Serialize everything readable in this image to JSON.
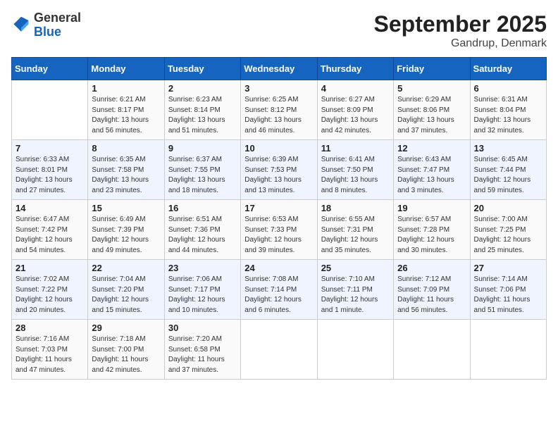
{
  "header": {
    "logo_general": "General",
    "logo_blue": "Blue",
    "month_title": "September 2025",
    "location": "Gandrup, Denmark"
  },
  "weekdays": [
    "Sunday",
    "Monday",
    "Tuesday",
    "Wednesday",
    "Thursday",
    "Friday",
    "Saturday"
  ],
  "weeks": [
    [
      {
        "day": "",
        "info": ""
      },
      {
        "day": "1",
        "info": "Sunrise: 6:21 AM\nSunset: 8:17 PM\nDaylight: 13 hours\nand 56 minutes."
      },
      {
        "day": "2",
        "info": "Sunrise: 6:23 AM\nSunset: 8:14 PM\nDaylight: 13 hours\nand 51 minutes."
      },
      {
        "day": "3",
        "info": "Sunrise: 6:25 AM\nSunset: 8:12 PM\nDaylight: 13 hours\nand 46 minutes."
      },
      {
        "day": "4",
        "info": "Sunrise: 6:27 AM\nSunset: 8:09 PM\nDaylight: 13 hours\nand 42 minutes."
      },
      {
        "day": "5",
        "info": "Sunrise: 6:29 AM\nSunset: 8:06 PM\nDaylight: 13 hours\nand 37 minutes."
      },
      {
        "day": "6",
        "info": "Sunrise: 6:31 AM\nSunset: 8:04 PM\nDaylight: 13 hours\nand 32 minutes."
      }
    ],
    [
      {
        "day": "7",
        "info": "Sunrise: 6:33 AM\nSunset: 8:01 PM\nDaylight: 13 hours\nand 27 minutes."
      },
      {
        "day": "8",
        "info": "Sunrise: 6:35 AM\nSunset: 7:58 PM\nDaylight: 13 hours\nand 23 minutes."
      },
      {
        "day": "9",
        "info": "Sunrise: 6:37 AM\nSunset: 7:55 PM\nDaylight: 13 hours\nand 18 minutes."
      },
      {
        "day": "10",
        "info": "Sunrise: 6:39 AM\nSunset: 7:53 PM\nDaylight: 13 hours\nand 13 minutes."
      },
      {
        "day": "11",
        "info": "Sunrise: 6:41 AM\nSunset: 7:50 PM\nDaylight: 13 hours\nand 8 minutes."
      },
      {
        "day": "12",
        "info": "Sunrise: 6:43 AM\nSunset: 7:47 PM\nDaylight: 13 hours\nand 3 minutes."
      },
      {
        "day": "13",
        "info": "Sunrise: 6:45 AM\nSunset: 7:44 PM\nDaylight: 12 hours\nand 59 minutes."
      }
    ],
    [
      {
        "day": "14",
        "info": "Sunrise: 6:47 AM\nSunset: 7:42 PM\nDaylight: 12 hours\nand 54 minutes."
      },
      {
        "day": "15",
        "info": "Sunrise: 6:49 AM\nSunset: 7:39 PM\nDaylight: 12 hours\nand 49 minutes."
      },
      {
        "day": "16",
        "info": "Sunrise: 6:51 AM\nSunset: 7:36 PM\nDaylight: 12 hours\nand 44 minutes."
      },
      {
        "day": "17",
        "info": "Sunrise: 6:53 AM\nSunset: 7:33 PM\nDaylight: 12 hours\nand 39 minutes."
      },
      {
        "day": "18",
        "info": "Sunrise: 6:55 AM\nSunset: 7:31 PM\nDaylight: 12 hours\nand 35 minutes."
      },
      {
        "day": "19",
        "info": "Sunrise: 6:57 AM\nSunset: 7:28 PM\nDaylight: 12 hours\nand 30 minutes."
      },
      {
        "day": "20",
        "info": "Sunrise: 7:00 AM\nSunset: 7:25 PM\nDaylight: 12 hours\nand 25 minutes."
      }
    ],
    [
      {
        "day": "21",
        "info": "Sunrise: 7:02 AM\nSunset: 7:22 PM\nDaylight: 12 hours\nand 20 minutes."
      },
      {
        "day": "22",
        "info": "Sunrise: 7:04 AM\nSunset: 7:20 PM\nDaylight: 12 hours\nand 15 minutes."
      },
      {
        "day": "23",
        "info": "Sunrise: 7:06 AM\nSunset: 7:17 PM\nDaylight: 12 hours\nand 10 minutes."
      },
      {
        "day": "24",
        "info": "Sunrise: 7:08 AM\nSunset: 7:14 PM\nDaylight: 12 hours\nand 6 minutes."
      },
      {
        "day": "25",
        "info": "Sunrise: 7:10 AM\nSunset: 7:11 PM\nDaylight: 12 hours\nand 1 minute."
      },
      {
        "day": "26",
        "info": "Sunrise: 7:12 AM\nSunset: 7:09 PM\nDaylight: 11 hours\nand 56 minutes."
      },
      {
        "day": "27",
        "info": "Sunrise: 7:14 AM\nSunset: 7:06 PM\nDaylight: 11 hours\nand 51 minutes."
      }
    ],
    [
      {
        "day": "28",
        "info": "Sunrise: 7:16 AM\nSunset: 7:03 PM\nDaylight: 11 hours\nand 47 minutes."
      },
      {
        "day": "29",
        "info": "Sunrise: 7:18 AM\nSunset: 7:00 PM\nDaylight: 11 hours\nand 42 minutes."
      },
      {
        "day": "30",
        "info": "Sunrise: 7:20 AM\nSunset: 6:58 PM\nDaylight: 11 hours\nand 37 minutes."
      },
      {
        "day": "",
        "info": ""
      },
      {
        "day": "",
        "info": ""
      },
      {
        "day": "",
        "info": ""
      },
      {
        "day": "",
        "info": ""
      }
    ]
  ]
}
